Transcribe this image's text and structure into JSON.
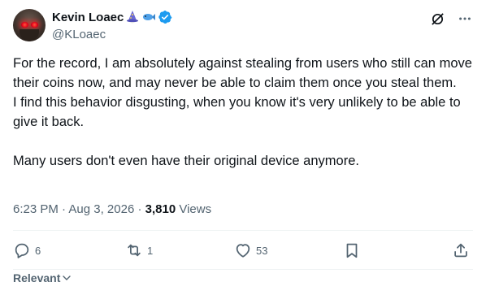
{
  "author": {
    "display_name": "Kevin Loaec",
    "handle": "@KLoaec",
    "emojis": [
      "wizard-emoji",
      "fish-emoji"
    ],
    "verified": true
  },
  "tweet": {
    "paragraph1": "For the record, I am absolutely against stealing from users who still can move their coins now, and may never be able to claim them once you steal them.",
    "paragraph2": "I find this behavior disgusting, when you know it's very unlikely to be able to give it back.",
    "paragraph3": "Many users don't even have their original device anymore."
  },
  "meta": {
    "time": "6:23 PM",
    "sep1": "·",
    "date": "Aug 3, 2026",
    "sep2": "·",
    "views_count": "3,810",
    "views_label": "Views"
  },
  "actions": {
    "replies": "6",
    "reposts": "1",
    "likes": "53"
  },
  "replies_sort": "Relevant",
  "colors": {
    "text": "#0f1419",
    "secondary": "#536471",
    "verified": "#1d9bf0",
    "divider": "#eff3f4"
  }
}
